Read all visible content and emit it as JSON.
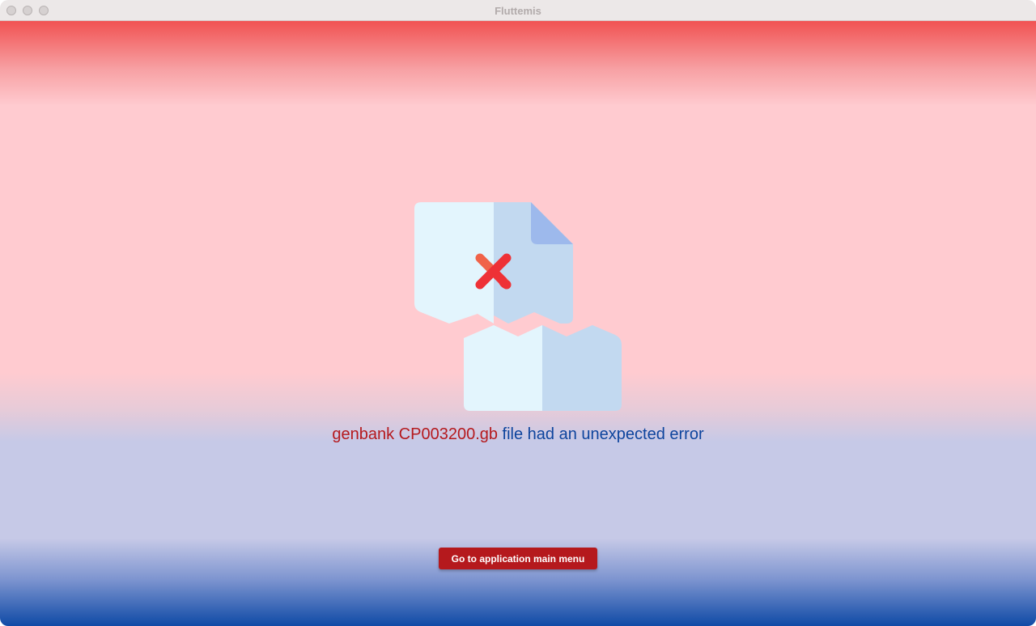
{
  "window": {
    "title": "Fluttemis"
  },
  "error": {
    "file_label": "genbank CP003200.gb",
    "message_rest": " file had an unexpected error"
  },
  "actions": {
    "main_menu_label": "Go to application main menu"
  },
  "colors": {
    "accent_red": "#b5191d",
    "accent_blue": "#0d449d",
    "x_mark": "#f0353b"
  },
  "icons": {
    "illustration": "broken-file-error-icon"
  }
}
